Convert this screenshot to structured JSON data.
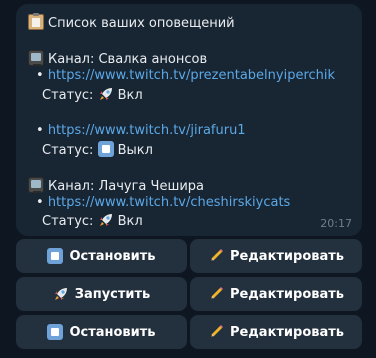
{
  "message": {
    "title": "Список ваших оповещений",
    "time": "20:17",
    "channels": [
      {
        "label": "Канал: Свалка анонсов",
        "streams": [
          {
            "url": "https://www.twitch.tv/prezentabelnyiperchik",
            "status_label": "Статус:",
            "status": "Вкл"
          },
          {
            "url": "https://www.twitch.tv/jirafuru1",
            "status_label": "Статус:",
            "status": "Выкл"
          }
        ]
      },
      {
        "label": "Канал: Лачуга Чешира",
        "streams": [
          {
            "url": "https://www.twitch.tv/cheshirskiycats",
            "status_label": "Статус:",
            "status": "Вкл"
          }
        ]
      }
    ],
    "bullet": "•"
  },
  "buttons": [
    {
      "left": "Остановить",
      "right": "Редактировать"
    },
    {
      "left": "Запустить",
      "right": "Редактировать"
    },
    {
      "left": "Остановить",
      "right": "Редактировать"
    }
  ],
  "icons": {
    "title": "clipboard-icon",
    "channel": "television-icon",
    "on": "rocket-icon",
    "off": "stop-button-icon",
    "edit": "pencil-icon"
  }
}
